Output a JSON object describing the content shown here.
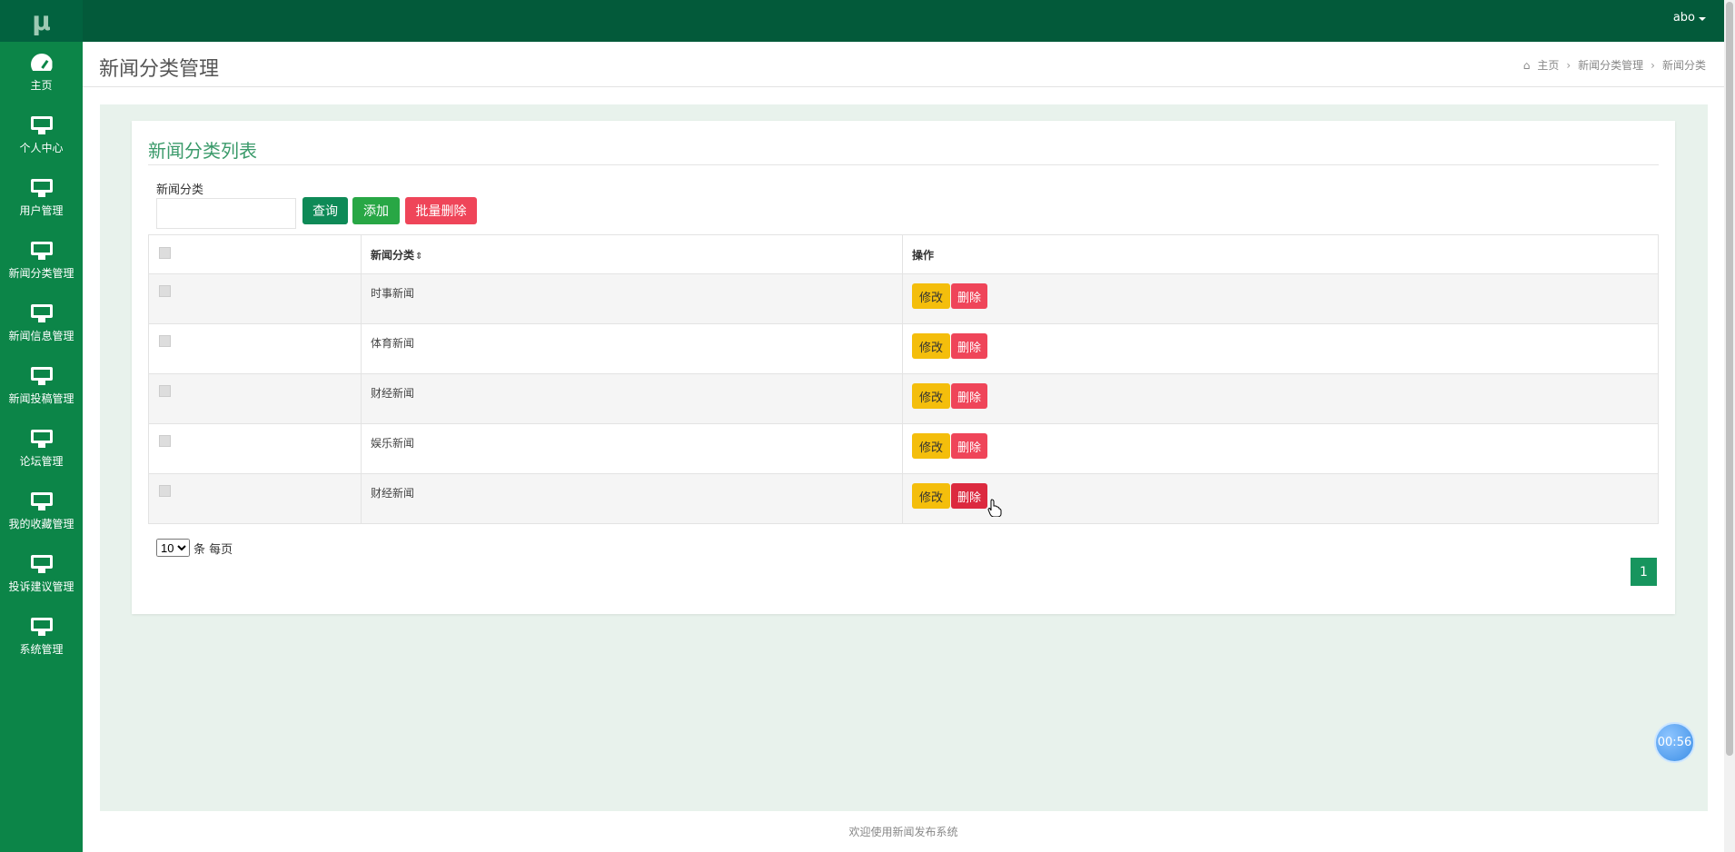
{
  "app": {
    "logo": "μ",
    "user": "abo"
  },
  "sidebar": {
    "items": [
      {
        "label": "主页",
        "icon": "dashboard-icon"
      },
      {
        "label": "个人中心",
        "icon": "monitor-icon"
      },
      {
        "label": "用户管理",
        "icon": "monitor-icon"
      },
      {
        "label": "新闻分类管理",
        "icon": "monitor-icon"
      },
      {
        "label": "新闻信息管理",
        "icon": "monitor-icon"
      },
      {
        "label": "新闻投稿管理",
        "icon": "monitor-icon"
      },
      {
        "label": "论坛管理",
        "icon": "monitor-icon"
      },
      {
        "label": "我的收藏管理",
        "icon": "monitor-icon"
      },
      {
        "label": "投诉建议管理",
        "icon": "monitor-icon"
      },
      {
        "label": "系统管理",
        "icon": "monitor-icon"
      }
    ]
  },
  "header": {
    "title": "新闻分类管理",
    "breadcrumb": [
      "主页",
      "新闻分类管理",
      "新闻分类"
    ]
  },
  "panel": {
    "title": "新闻分类列表",
    "filter_label": "新闻分类",
    "filter_value": "",
    "buttons": {
      "query": "查询",
      "add": "添加",
      "bulk_delete": "批量删除"
    }
  },
  "table": {
    "headers": {
      "category": "新闻分类",
      "sort": "⇕",
      "actions": "操作"
    },
    "edit_label": "修改",
    "delete_label": "删除",
    "rows": [
      {
        "category": "时事新闻"
      },
      {
        "category": "体育新闻"
      },
      {
        "category": "财经新闻"
      },
      {
        "category": "娱乐新闻"
      },
      {
        "category": "财经新闻"
      }
    ]
  },
  "pagination": {
    "page_size": "10",
    "page_size_options": [
      "10"
    ],
    "per_page_label": "条 每页",
    "current_page": "1"
  },
  "footer": {
    "text": "欢迎使用新闻发布系统"
  },
  "timer": {
    "text": "00:56"
  },
  "colors": {
    "topbar": "#035a3a",
    "sidebar": "#0c8548",
    "primary": "#0e8a57",
    "success": "#28a745",
    "danger": "#ef4559",
    "warning": "#f4be0c"
  }
}
